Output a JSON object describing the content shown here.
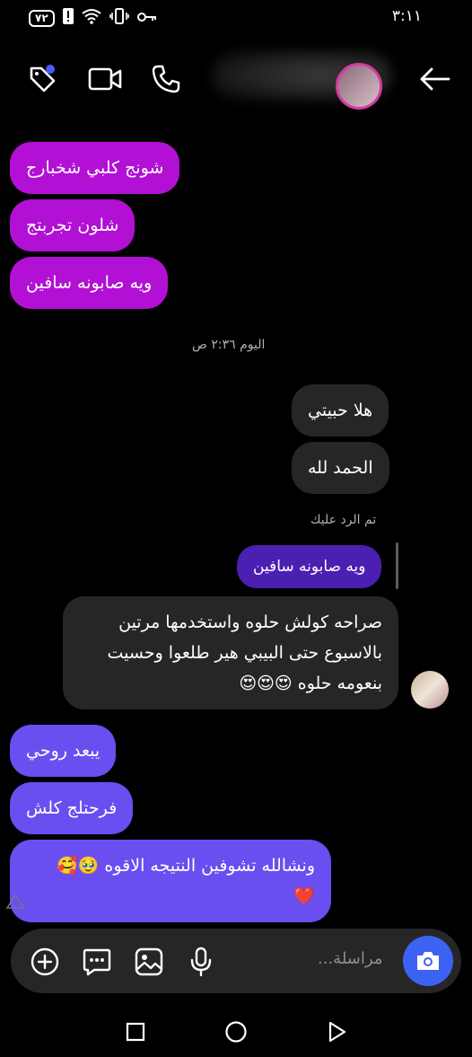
{
  "status_bar": {
    "time": "٣:١١",
    "battery": "٧٢"
  },
  "header": {
    "title_blurred": true
  },
  "messages": {
    "m1": "شونج كلبي شخبارج",
    "m2": "شلون تجربتج",
    "m3": "ويه صابونه سافين",
    "timestamp": "اليوم ٢:٣٦ ص",
    "r1": "هلا حبيتي",
    "r2": "الحمد لله",
    "reply_label": "تم الرد عليك",
    "reply_quote": "ويه صابونه سافين",
    "r3_line1": "صراحه كولش حلوه واستخدمها مرتين",
    "r3_line2": "بالاسبوع حتى البيبي هير طلعوا وحسيت",
    "r3_line3": "بنعومه حلوه 😍😍😍",
    "s1": "يبعد روحي",
    "s2": "فرحتلج كلش",
    "s3_line1": "ونشالله تشوفين النتيجه الاقوه 🥹🥰",
    "s3_line2": "❤️"
  },
  "composer": {
    "placeholder": "مراسلة..."
  },
  "colors": {
    "sent_magenta": "#b210d4",
    "sent_violet": "#6b4ef0",
    "received": "#262626",
    "accent": "#3c62f2"
  }
}
